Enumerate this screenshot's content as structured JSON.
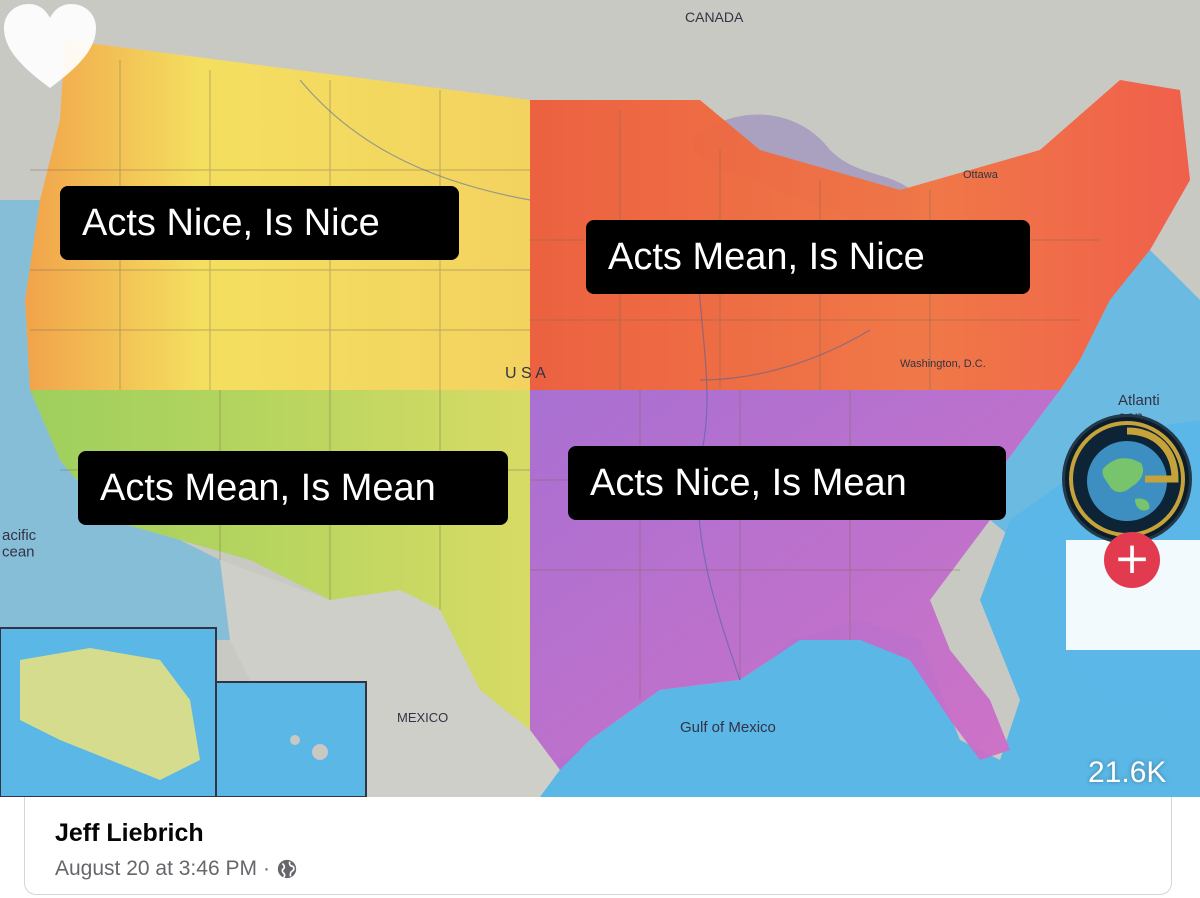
{
  "post": {
    "author": "Jeff Liebrich",
    "timestamp": "August 20 at 3:46 PM",
    "separator": "·",
    "privacy_icon": "globe-icon"
  },
  "overlay": {
    "quadrants": {
      "northwest": "Acts Nice, Is Nice",
      "northeast": "Acts Mean, Is Nice",
      "southwest": "Acts Mean, Is Mean",
      "southeast": "Acts Nice, Is Mean"
    },
    "likes": "21.6K",
    "follow_symbol": "+",
    "avatar_icon": "globe-logo-icon",
    "like_icon": "heart-icon"
  },
  "map": {
    "labels": {
      "canada": "CANADA",
      "mexico": "MEXICO",
      "gulf": "Gulf of Mexico",
      "usa": "U S A",
      "pacific": "acific\ncean",
      "atlantic": "Atlanti\nean",
      "ottawa": "Ottawa",
      "washington": "Washington, D.C."
    }
  },
  "colors": {
    "water": "#5ab7e6",
    "land": "#c9c9c4",
    "nw_fill": "#f3d25f",
    "ne_fill": "#f06a3e",
    "sw_fill": "#a8d05a",
    "se_fill": "#b36ad0",
    "label_bg": "#000000",
    "plus_bg": "#e23b4f"
  }
}
